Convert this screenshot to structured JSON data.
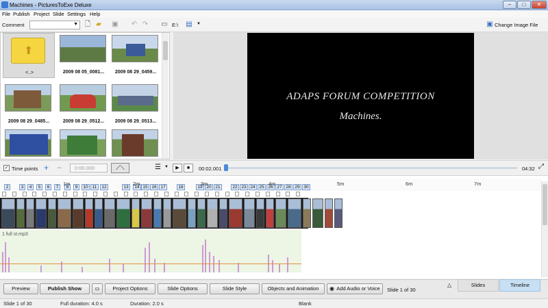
{
  "window": {
    "title": "Machines - PicturesToExe Deluxe",
    "min": "–",
    "max": "□",
    "close": "✕"
  },
  "menu": [
    "File",
    "Publish",
    "Project",
    "Slide",
    "Settings",
    "Help"
  ],
  "toolbar": {
    "comment_label": "Comment",
    "drive_label": "E:\\",
    "change_image_label": "Change Image File"
  },
  "browser": {
    "items": [
      {
        "caption": "<..>",
        "kind": "folder",
        "color": "#f5d640"
      },
      {
        "caption": "2009 08 05_0081...",
        "color": "#5e7a44"
      },
      {
        "caption": "2009 08 29_0459...",
        "color": "#4c6fa0"
      },
      {
        "caption": "2009 08 29_0485...",
        "color": "#7c5a3a"
      },
      {
        "caption": "2009 08 29_0512...",
        "color": "#c93c34"
      },
      {
        "caption": "2009 08 29_0513...",
        "color": "#5a6a8a"
      },
      {
        "caption": "",
        "color": "#2f4fa0"
      },
      {
        "caption": "",
        "color": "#3e7c3a"
      },
      {
        "caption": "",
        "color": "#6a3a2a"
      }
    ]
  },
  "preview": {
    "line1": "ADAPS FORUM COMPETITION",
    "line2": "Machines."
  },
  "controls": {
    "time_points_label": "Time points",
    "time_value": "0:00.000",
    "position": "00:02.001",
    "duration": "04:32",
    "progress": 0.0
  },
  "timeline": {
    "slide_numbers": [
      "2",
      "3",
      "4",
      "5",
      "6",
      "7",
      "8",
      "9",
      "10",
      "11",
      "12",
      "13",
      "14",
      "15",
      "16",
      "17",
      "18",
      "19",
      "20",
      "21",
      "22",
      "23",
      "24",
      "25",
      "26",
      "27",
      "28",
      "29",
      "30"
    ],
    "ruler_marks": [
      "1m",
      "2m",
      "3m",
      "4m",
      "5m",
      "6m",
      "7m"
    ],
    "frames": [
      "#3b4a5a",
      "#556b3a",
      "#7a7a7a",
      "#2a3a6a",
      "#4a5a3a",
      "#8a6a4a",
      "#5a3a2a",
      "#b33a2a",
      "#3a5a8a",
      "#6a6a6a",
      "#2f6f3f",
      "#d8c848",
      "#8a3a3a",
      "#4a7ab0",
      "#9a9a9a",
      "#5a4a3a",
      "#7aa0c0",
      "#3a6a4a",
      "#b0b0b0",
      "#4a4a6a",
      "#9a3a30",
      "#7a8a9a",
      "#3a3a3a",
      "#c04040",
      "#6a8a5a",
      "#4a6a8a",
      "#8a7a5a",
      "#3a5a3a",
      "#a04a3a",
      "#5a5a7a"
    ],
    "audio_label": "1  full st.mp3"
  },
  "bottom": {
    "preview": "Preview",
    "publish_show": "Publish Show",
    "project_options": "Project Options",
    "slide_options": "Slide Options",
    "slide_style": "Slide Style",
    "objects_animation": "Objects and Animation",
    "add_audio": "Add Audio or Voice",
    "slide_counter": "Slide 1 of 30",
    "tab_slides": "Slides",
    "tab_timeline": "Timeline"
  },
  "status": {
    "slide": "Slide 1 of 30",
    "full_duration": "Full duration: 4.0 s",
    "duration": "Duration: 2.0 s",
    "transition": "Blank"
  }
}
